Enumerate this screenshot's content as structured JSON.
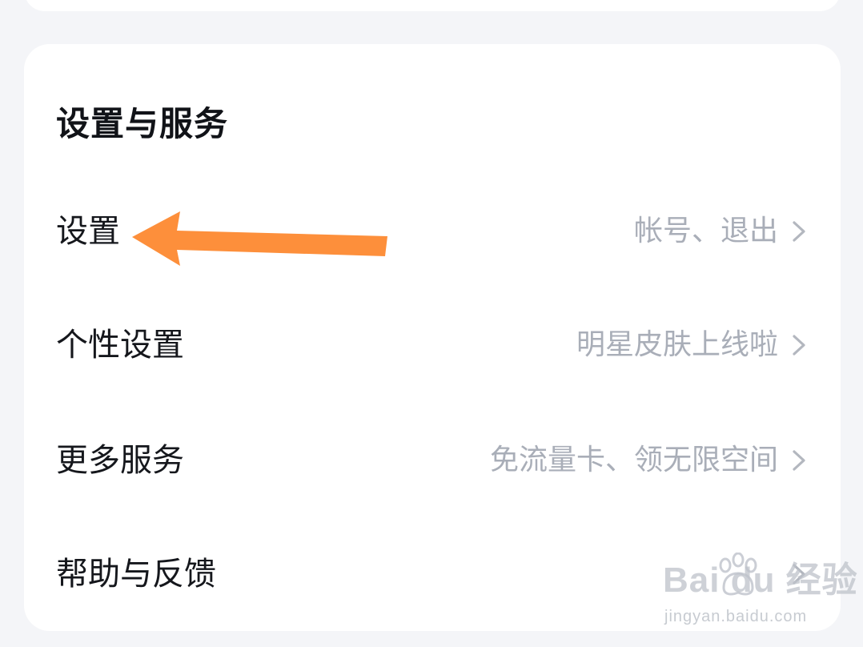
{
  "section": {
    "title": "设置与服务"
  },
  "rows": [
    {
      "label": "设置",
      "sub": "帐号、退出"
    },
    {
      "label": "个性设置",
      "sub": "明星皮肤上线啦"
    },
    {
      "label": "更多服务",
      "sub": "免流量卡、领无限空间"
    },
    {
      "label": "帮助与反馈",
      "sub": ""
    }
  ],
  "annotation": {
    "arrow_color": "#fd8f3b"
  },
  "watermark": {
    "logo_text": "Bai  du 经验",
    "url": "jingyan.baidu.com"
  },
  "colors": {
    "background": "#f4f5f8",
    "card": "#ffffff",
    "title": "#111318",
    "label": "#15171c",
    "subtext": "#a9aeb8",
    "chevron": "#b3b7bf"
  }
}
